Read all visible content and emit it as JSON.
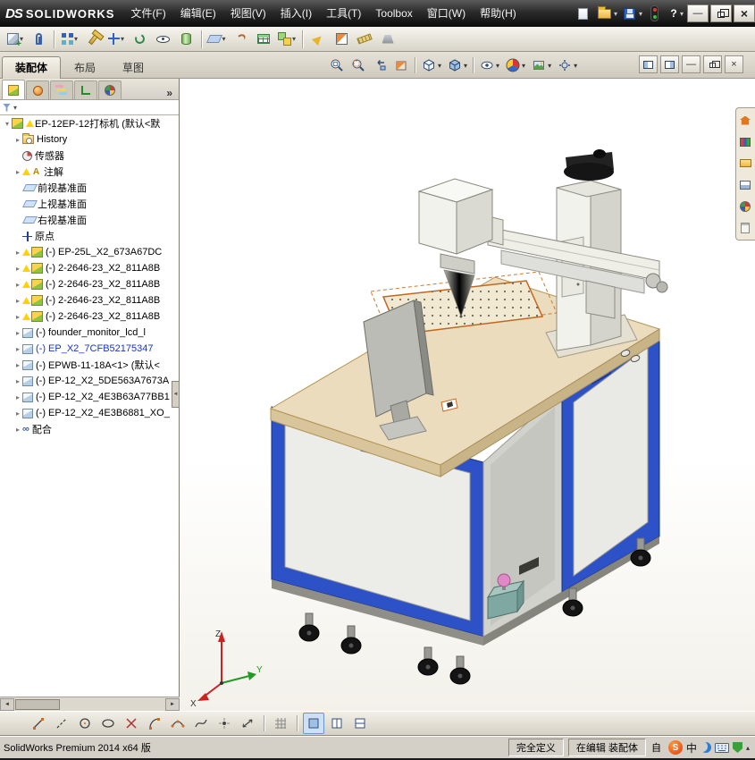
{
  "glyphs": {
    "dropdown": "▾",
    "expander_collapsed": "▸",
    "expander_expanded": "▾",
    "overflow": "»",
    "minimize": "—",
    "close": "×",
    "scroll_left": "◄",
    "scroll_right": "►",
    "splitter": "◄",
    "help": "?",
    "annotation_a": "A",
    "mates": "∞",
    "sogou": "S",
    "tray_arrow": "▴"
  },
  "titlebar": {
    "logo_mark": "DS",
    "logo_text": "SOLIDWORKS",
    "menus": [
      "文件(F)",
      "编辑(E)",
      "视图(V)",
      "插入(I)",
      "工具(T)",
      "Toolbox",
      "窗口(W)",
      "帮助(H)"
    ]
  },
  "main_toolbar": {
    "buttons": [
      "insert-component",
      "mate",
      "linear-component-pattern",
      "smart-fasteners",
      "move-component",
      "rotate-component",
      "show-hidden-components",
      "assembly-features",
      "reference-geometry",
      "curves",
      "bill-of-materials",
      "exploded-view",
      "instant-3d",
      "section-view",
      "measure",
      "mass-properties"
    ]
  },
  "command_tabs": {
    "items": [
      "装配体",
      "布局",
      "草图"
    ],
    "active_index": 0
  },
  "hud": {
    "buttons": [
      "zoom-to-fit",
      "zoom-to-area",
      "previous-view",
      "section-view",
      "view-orientation",
      "display-style",
      "hide-show-items",
      "edit-appearance",
      "apply-scene",
      "view-settings"
    ]
  },
  "doc_window": {
    "buttons": [
      "split-left",
      "split-right",
      "minimize",
      "restore",
      "close"
    ]
  },
  "feature_panel": {
    "tabs": [
      "featuremanager-tree",
      "propertymanager",
      "configurationmanager",
      "dimxpertmanager",
      "displaymanager"
    ]
  },
  "feature_tree": {
    "items": [
      {
        "label": "EP-12EP-12打标机 (默认<默"
      },
      {
        "label": "History"
      },
      {
        "label": "传感器"
      },
      {
        "label": "注解"
      },
      {
        "label": "前视基准面"
      },
      {
        "label": "上视基准面"
      },
      {
        "label": "右视基准面"
      },
      {
        "label": "原点"
      },
      {
        "label": "(-) EP-25L_X2_673A67DC"
      },
      {
        "label": "(-) 2-2646-23_X2_811A8B"
      },
      {
        "label": "(-) 2-2646-23_X2_811A8B"
      },
      {
        "label": "(-) 2-2646-23_X2_811A8B"
      },
      {
        "label": "(-) 2-2646-23_X2_811A8B"
      },
      {
        "label": "(-) founder_monitor_lcd_l"
      },
      {
        "label": "(-) EP_X2_7CFB52175347"
      },
      {
        "label": "(-) EPWB-11-18A<1> (默认<"
      },
      {
        "label": "(-) EP-12_X2_5DE563A7673A"
      },
      {
        "label": "(-) EP-12_X2_4E3B63A77BB1"
      },
      {
        "label": "(-) EP-12_X2_4E3B6881_XO_"
      },
      {
        "label": "配合"
      }
    ]
  },
  "viewport": {
    "triad": {
      "x": "X",
      "y": "Y",
      "z": "Z"
    }
  },
  "taskpane": {
    "buttons": [
      "solidworks-resources",
      "design-library",
      "file-explorer",
      "view-palette",
      "appearances-scenes",
      "custom-properties"
    ]
  },
  "sketch_toolbar": {
    "buttons": [
      "sketch-line",
      "centerline",
      "circle",
      "ellipse",
      "trim-entities",
      "tangent-arc",
      "3-point-arc",
      "spline",
      "point",
      "smart-dimension",
      "grid-snap",
      "viewport-single",
      "viewport-two-horizontal",
      "viewport-two-vertical"
    ],
    "active": "viewport-single"
  },
  "statusbar": {
    "product": "SolidWorks Premium 2014 x64 版",
    "define_state": "完全定义",
    "edit_state": "在编辑 装配体",
    "custom_label": "自",
    "lang_indicator": "中"
  },
  "colors": {
    "cabinet_blue": "#2d52c8",
    "tabletop_tan": "#ecdcbe",
    "warning_yellow": "#ffd200",
    "selection_blue": "#1636c8"
  }
}
